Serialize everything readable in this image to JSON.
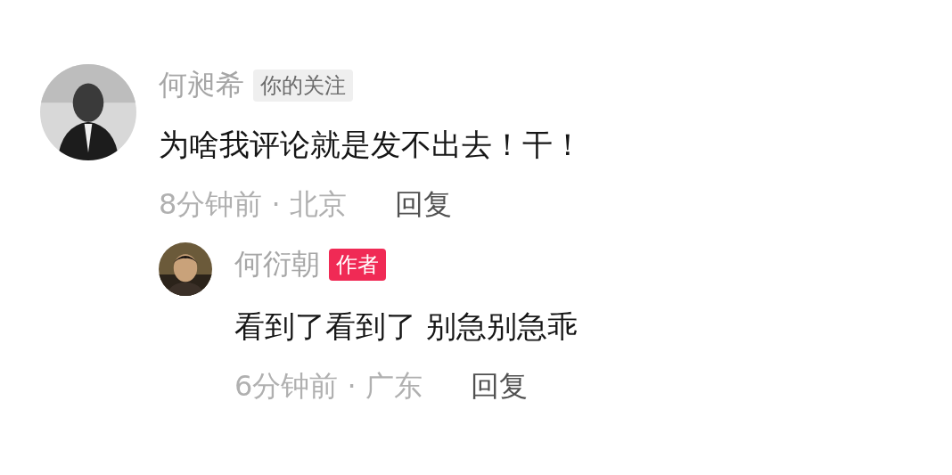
{
  "comments": [
    {
      "author": "何昶希",
      "badge": {
        "kind": "following",
        "text": "你的关注"
      },
      "text": "为啥我评论就是发不出去！干！",
      "time_location": "8分钟前 · 北京",
      "reply_label": "回复",
      "replies": [
        {
          "author": "何衍朝",
          "badge": {
            "kind": "author",
            "text": "作者"
          },
          "text": "看到了看到了 别急别急乖",
          "time_location": "6分钟前 · 广东",
          "reply_label": "回复"
        }
      ]
    }
  ]
}
